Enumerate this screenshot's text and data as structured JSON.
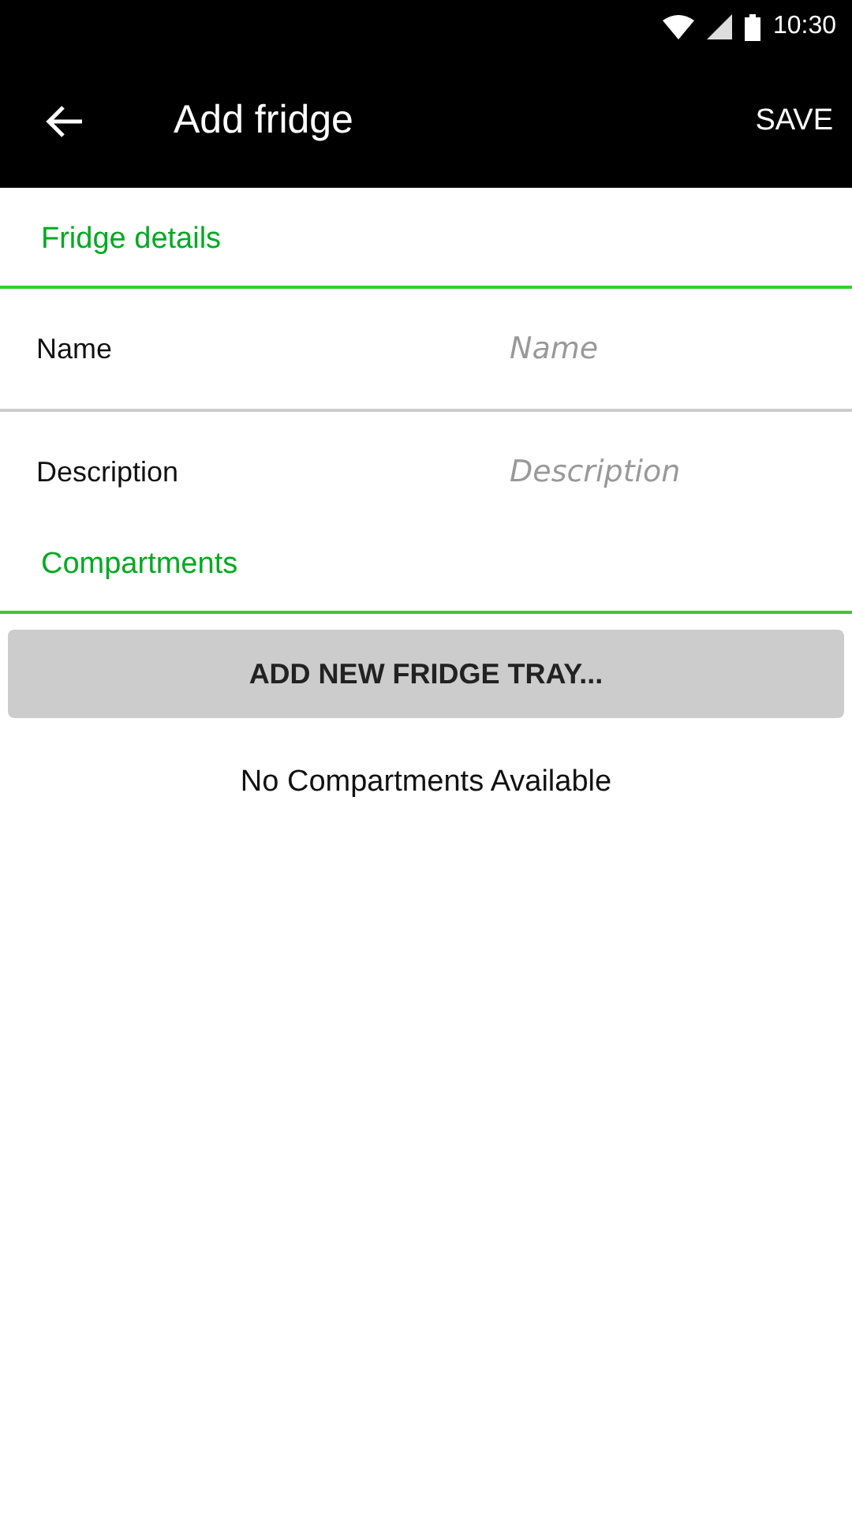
{
  "status_bar": {
    "time": "10:30"
  },
  "toolbar": {
    "title": "Add fridge",
    "action": "SAVE"
  },
  "details": {
    "title": "Fridge details",
    "fields": [
      {
        "label": "Name",
        "placeholder": "Name"
      },
      {
        "label": "Description",
        "placeholder": "Description"
      }
    ]
  },
  "compartments": {
    "title": "Compartments",
    "button": "ADD NEW FRIDGE TRAY...",
    "empty_text": "No Compartments Available"
  }
}
